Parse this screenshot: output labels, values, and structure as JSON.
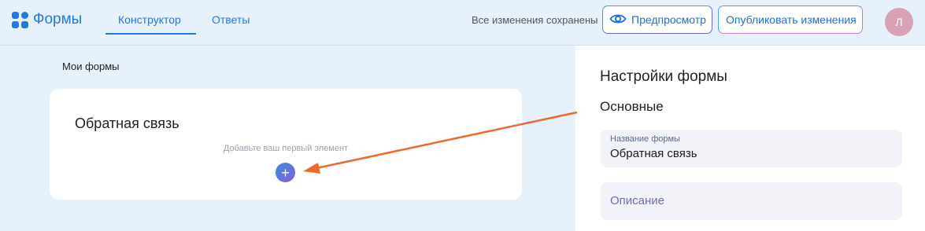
{
  "header": {
    "logo_text": "Формы",
    "tabs": [
      {
        "label": "Конструктор",
        "active": true
      },
      {
        "label": "Ответы",
        "active": false
      }
    ],
    "saved_status": "Все изменения сохранены",
    "preview_label": "Предпросмотр",
    "publish_label": "Опубликовать изменения",
    "avatar_initial": "Л"
  },
  "main": {
    "breadcrumb": "Мои формы",
    "form_title": "Обратная связь",
    "empty_hint": "Добавьте ваш первый элемент",
    "add_icon": "plus-icon"
  },
  "settings": {
    "title": "Настройки формы",
    "section": "Основные",
    "name_field": {
      "label": "Название формы",
      "value": "Обратная связь"
    },
    "description_field": {
      "placeholder": "Описание",
      "value": ""
    }
  },
  "colors": {
    "accent": "#1f7ae0",
    "background": "#e6f1fb",
    "annotation_arrow": "#ee6a2a",
    "avatar": "#d8a1b5"
  }
}
